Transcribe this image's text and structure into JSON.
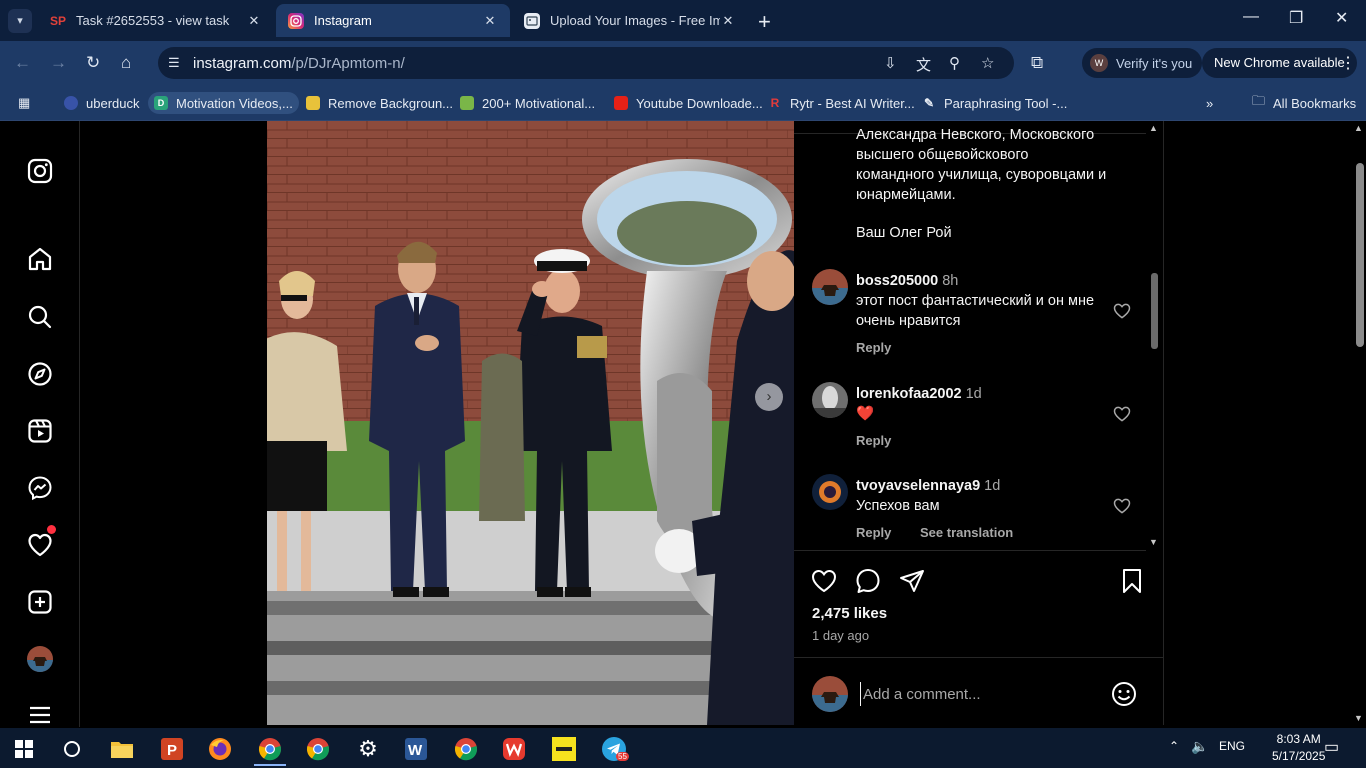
{
  "browser": {
    "tabs": [
      {
        "title": "Task #2652553 - view task",
        "icon": "sp-favicon"
      },
      {
        "title": "Instagram",
        "icon": "instagram-favicon"
      },
      {
        "title": "Upload Your Images - Free Imag",
        "icon": "upload-favicon"
      }
    ],
    "address": {
      "host": "instagram.com",
      "path": "/p/DJrApmtom-n/"
    },
    "verify_label": "Verify it's you",
    "update_label": "New Chrome available",
    "bookmarks": [
      {
        "label": "uberduck"
      },
      {
        "label": "Motivation Videos,..."
      },
      {
        "label": "Remove Backgroun..."
      },
      {
        "label": "200+ Motivational..."
      },
      {
        "label": "Youtube Downloade..."
      },
      {
        "label": "Rytr - Best AI Writer..."
      },
      {
        "label": "Paraphrasing Tool -..."
      }
    ],
    "all_bookmarks_label": "All Bookmarks"
  },
  "post": {
    "caption_lines": [
      "Александра Невского, Московского",
      "высшего общевойскового",
      "командного училища, суворовцами и",
      "юнармейцами."
    ],
    "signature": "Ваш Олег Рой",
    "comments": [
      {
        "user": "boss205000",
        "time": "8h",
        "text": "этот пост фантастический и он мне очень нравится",
        "reply": "Reply"
      },
      {
        "user": "lorenkofaa2002",
        "time": "1d",
        "text": "❤️",
        "reply": "Reply"
      },
      {
        "user": "tvoyavselennaya9",
        "time": "1d",
        "text": "Успехов вам",
        "reply": "Reply",
        "translate": "See translation"
      }
    ],
    "likes": "2,475 likes",
    "posted": "1 day ago",
    "comment_placeholder": "Add a comment..."
  },
  "taskbar": {
    "language": "ENG",
    "time": "8:03 AM",
    "date": "5/17/2025",
    "telegram_badge": "55"
  },
  "colors": {
    "tab_strip": "#0d1f3c",
    "toolbar": "#1e3a66",
    "notification": "#ff3040",
    "heart": "#ff3040"
  }
}
